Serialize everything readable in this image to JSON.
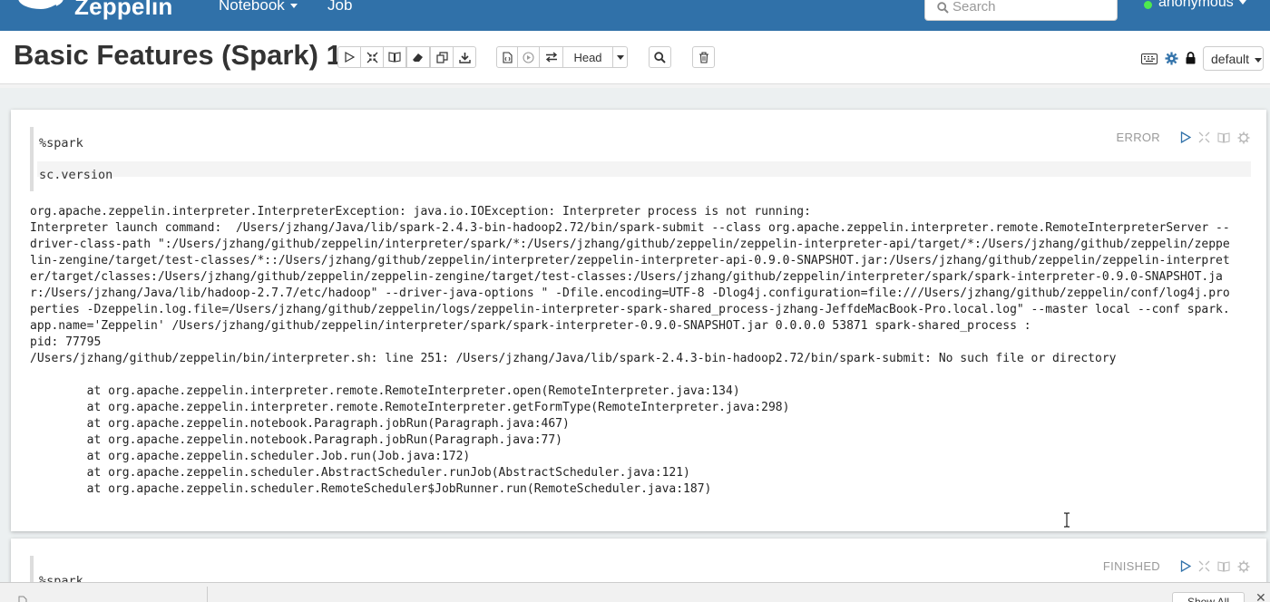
{
  "navbar": {
    "brand": "Zeppelin",
    "notebook_label": "Notebook",
    "job_label": "Job",
    "search_placeholder": "Search",
    "user": "anonymous"
  },
  "notebook": {
    "title": "Basic Features (Spark) 1",
    "revision_label": "Head",
    "interpreter_label": "default"
  },
  "paragraphs": [
    {
      "interpreter": "%spark",
      "code": "sc.version",
      "status": "ERROR",
      "output": "org.apache.zeppelin.interpreter.InterpreterException: java.io.IOException: Interpreter process is not running:\nInterpreter launch command:  /Users/jzhang/Java/lib/spark-2.4.3-bin-hadoop2.72/bin/spark-submit --class org.apache.zeppelin.interpreter.remote.RemoteInterpreterServer --\ndriver-class-path \":/Users/jzhang/github/zeppelin/interpreter/spark/*:/Users/jzhang/github/zeppelin/zeppelin-interpreter-api/target/*:/Users/jzhang/github/zeppelin/zeppe\nlin-zengine/target/test-classes/*::/Users/jzhang/github/zeppelin/interpreter/zeppelin-interpreter-api-0.9.0-SNAPSHOT.jar:/Users/jzhang/github/zeppelin/zeppelin-interpret\ner/target/classes:/Users/jzhang/github/zeppelin/zeppelin-zengine/target/test-classes:/Users/jzhang/github/zeppelin/interpreter/spark/spark-interpreter-0.9.0-SNAPSHOT.ja\nr:/Users/jzhang/Java/lib/hadoop-2.7.7/etc/hadoop\" --driver-java-options \" -Dfile.encoding=UTF-8 -Dlog4j.configuration=file:///Users/jzhang/github/zeppelin/conf/log4j.pro\nperties -Dzeppelin.log.file=/Users/jzhang/github/zeppelin/logs/zeppelin-interpreter-spark-shared_process-jzhang-JeffdeMacBook-Pro.local.log\" --master local --conf spark.\napp.name='Zeppelin' /Users/jzhang/github/zeppelin/interpreter/spark/spark-interpreter-0.9.0-SNAPSHOT.jar 0.0.0.0 53871 spark-shared_process :\npid: 77795\n/Users/jzhang/github/zeppelin/bin/interpreter.sh: line 251: /Users/jzhang/Java/lib/spark-2.4.3-bin-hadoop2.72/bin/spark-submit: No such file or directory\n\n        at org.apache.zeppelin.interpreter.remote.RemoteInterpreter.open(RemoteInterpreter.java:134)\n        at org.apache.zeppelin.interpreter.remote.RemoteInterpreter.getFormType(RemoteInterpreter.java:298)\n        at org.apache.zeppelin.notebook.Paragraph.jobRun(Paragraph.java:467)\n        at org.apache.zeppelin.notebook.Paragraph.jobRun(Paragraph.java:77)\n        at org.apache.zeppelin.scheduler.Job.run(Job.java:172)\n        at org.apache.zeppelin.scheduler.AbstractScheduler.runJob(AbstractScheduler.java:121)\n        at org.apache.zeppelin.scheduler.RemoteScheduler$JobRunner.run(RemoteScheduler.java:187)"
    },
    {
      "interpreter": "%spark",
      "status": "FINISHED"
    }
  ],
  "download_bar": {
    "show_all": "Show All",
    "close": "✕"
  },
  "colors": {
    "navbar": "#3071a9",
    "accent": "#3071a9",
    "status_muted": "#999999"
  }
}
